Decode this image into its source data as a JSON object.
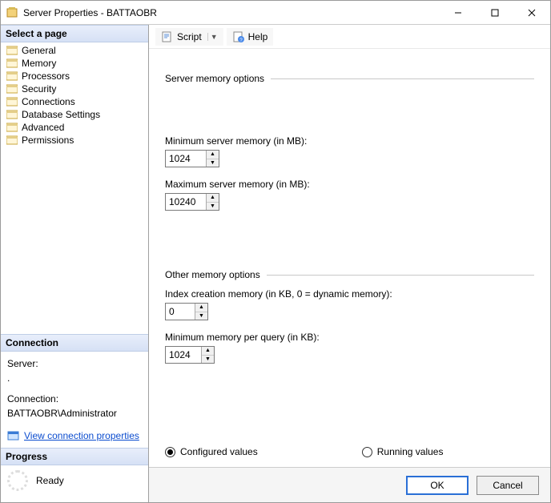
{
  "window": {
    "title": "Server Properties - BATTAOBR"
  },
  "sidebar": {
    "select_page_header": "Select a page",
    "pages": [
      {
        "label": "General"
      },
      {
        "label": "Memory"
      },
      {
        "label": "Processors"
      },
      {
        "label": "Security"
      },
      {
        "label": "Connections"
      },
      {
        "label": "Database Settings"
      },
      {
        "label": "Advanced"
      },
      {
        "label": "Permissions"
      }
    ],
    "connection_header": "Connection",
    "server_label": "Server:",
    "server_value": ".",
    "connection_label": "Connection:",
    "connection_value": "BATTAOBR\\Administrator",
    "view_props_link": "View connection properties",
    "progress_header": "Progress",
    "progress_status": "Ready"
  },
  "toolbar": {
    "script_label": "Script",
    "help_label": "Help"
  },
  "content": {
    "group1": "Server memory options",
    "min_mem_label": "Minimum server memory (in MB):",
    "min_mem_value": "1024",
    "max_mem_label": "Maximum server memory (in MB):",
    "max_mem_value": "10240",
    "group2": "Other memory options",
    "index_mem_label": "Index creation memory (in KB, 0 = dynamic memory):",
    "index_mem_value": "0",
    "min_query_label": "Minimum memory per query (in KB):",
    "min_query_value": "1024",
    "radio_configured": "Configured values",
    "radio_running": "Running values"
  },
  "footer": {
    "ok": "OK",
    "cancel": "Cancel"
  }
}
